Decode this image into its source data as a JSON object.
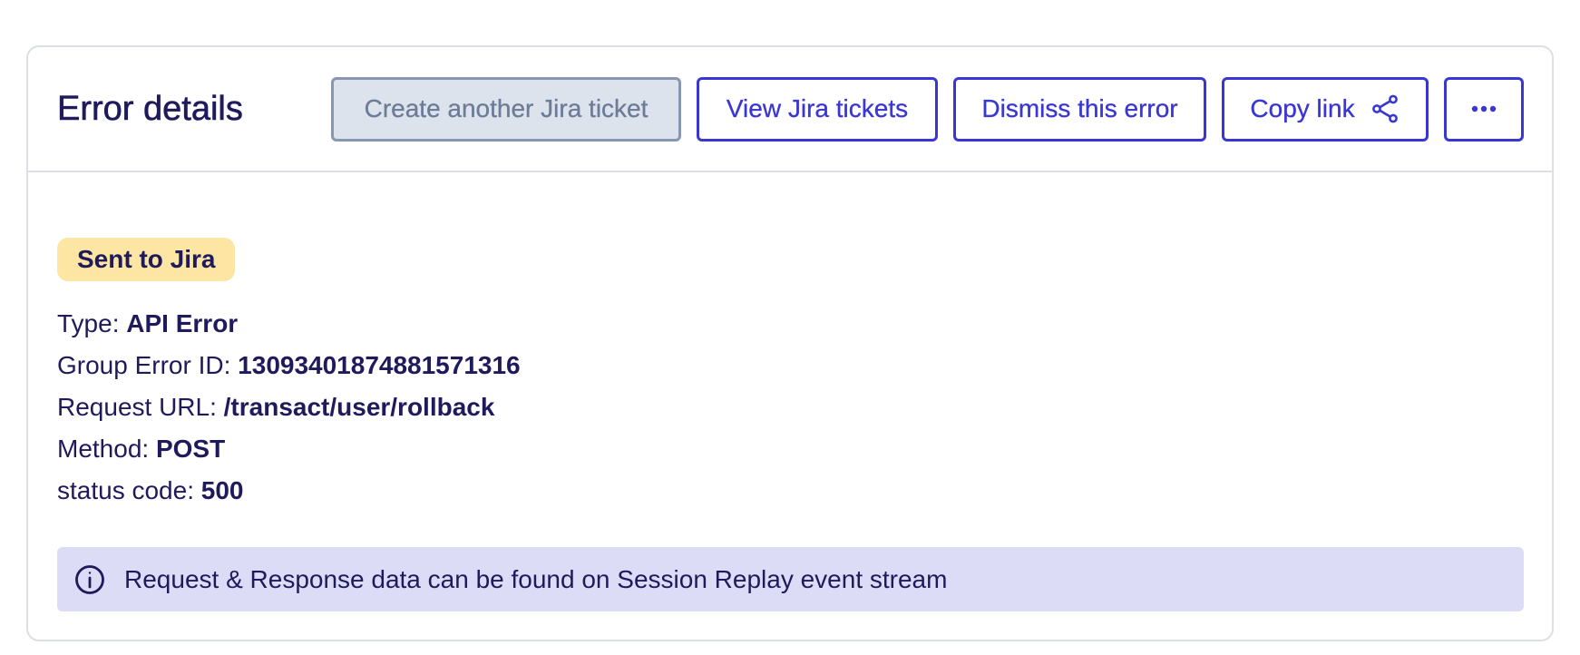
{
  "header": {
    "title": "Error details",
    "actions": {
      "create_ticket": "Create another Jira ticket",
      "view_tickets": "View Jira tickets",
      "dismiss": "Dismiss this error",
      "copy_link": "Copy link",
      "copy_link_icon": "share-icon",
      "more_icon": "more-horizontal-icon"
    }
  },
  "body": {
    "badge": "Sent to Jira",
    "details": [
      {
        "label": "Type: ",
        "value": "API Error"
      },
      {
        "label": "Group Error ID: ",
        "value": "13093401874881571316"
      },
      {
        "label": "Request URL: ",
        "value": "/transact/user/rollback"
      },
      {
        "label": "Method: ",
        "value": "POST"
      },
      {
        "label": "status code: ",
        "value": "500"
      }
    ],
    "info_banner": {
      "icon": "info-icon",
      "text": "Request & Response data can be found on Session Replay event stream"
    }
  },
  "colors": {
    "accent": "#3a36d4",
    "text": "#1f1a5c",
    "badge_bg": "#fde6a3",
    "banner_bg": "#dcdcf7",
    "disabled_bg": "#dde3ec",
    "border": "#dcdfe6"
  }
}
